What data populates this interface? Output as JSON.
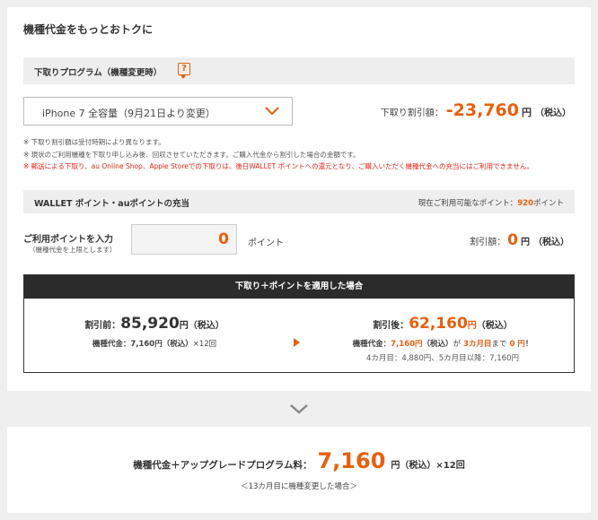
{
  "section_title": "機種代金をもっとおトクに",
  "tradein_bar": {
    "label": "下取りプログラム（機種変更時）",
    "help_glyph": "?"
  },
  "device_select": {
    "value": "iPhone 7 全容量（9月21日より変更）",
    "icon": "chevron-down-icon"
  },
  "tradein_discount": {
    "label": "下取り割引額：",
    "amount": "-23,760",
    "unit": "円",
    "tax": "（税込）"
  },
  "notes": [
    "※ 下取り割引額は受付時期により異なります。",
    "※ 現状のご利用機種を下取り申し込み後、回収させていただきます。ご購入代金から割引した場合の金額です。",
    "※ 郵送による下取り、au Online Shop、Apple Storeでの下取りは、後日WALLET ポイントへの還元となり、ご購入いただく機種代金への充当にはご利用できません。"
  ],
  "points_bar": {
    "label": "WALLET ポイント・auポイントの充当",
    "available_prefix": "現在ご利用可能なポイント：",
    "available_value": "920",
    "available_suffix": "ポイント"
  },
  "points_input": {
    "label": "ご利用ポイントを入力",
    "sublabel": "（機種代金を上限とします）",
    "value": "0",
    "unit": "ポイント"
  },
  "points_discount": {
    "label": "割引額：",
    "amount": "0",
    "unit": "円",
    "tax": "（税込）"
  },
  "summary": {
    "header": "下取り＋ポイントを適用した場合",
    "before": {
      "label": "割引前：",
      "amount": "85,920",
      "unit": "円",
      "tax": "（税込）",
      "monthly_label": "機種代金：",
      "monthly": "7,160円",
      "monthly_tax": "（税込）",
      "monthly_suffix": "×12回"
    },
    "after": {
      "label": "割引後：",
      "amount": "62,160",
      "unit": "円",
      "tax": "（税込）",
      "monthly_label": "機種代金：",
      "monthly": "7,160円",
      "monthly_tax": "（税込）",
      "ga": "が",
      "month_highlight": "3カ月目",
      "made": "まで",
      "zero": "0 円",
      "bang": "！",
      "detail": "4カ月目：4,880円、5カ月目以降：7,160円"
    }
  },
  "final": {
    "label": "機種代金＋アップグレードプログラム料：",
    "amount": "7,160",
    "unit": "円",
    "tax": "（税込）",
    "times": "×12回",
    "note": "＜13カ月目に機種変更した場合＞"
  },
  "colors": {
    "accent": "#e95f0e",
    "warning": "#e0261a",
    "dark": "#2b2b2b"
  }
}
